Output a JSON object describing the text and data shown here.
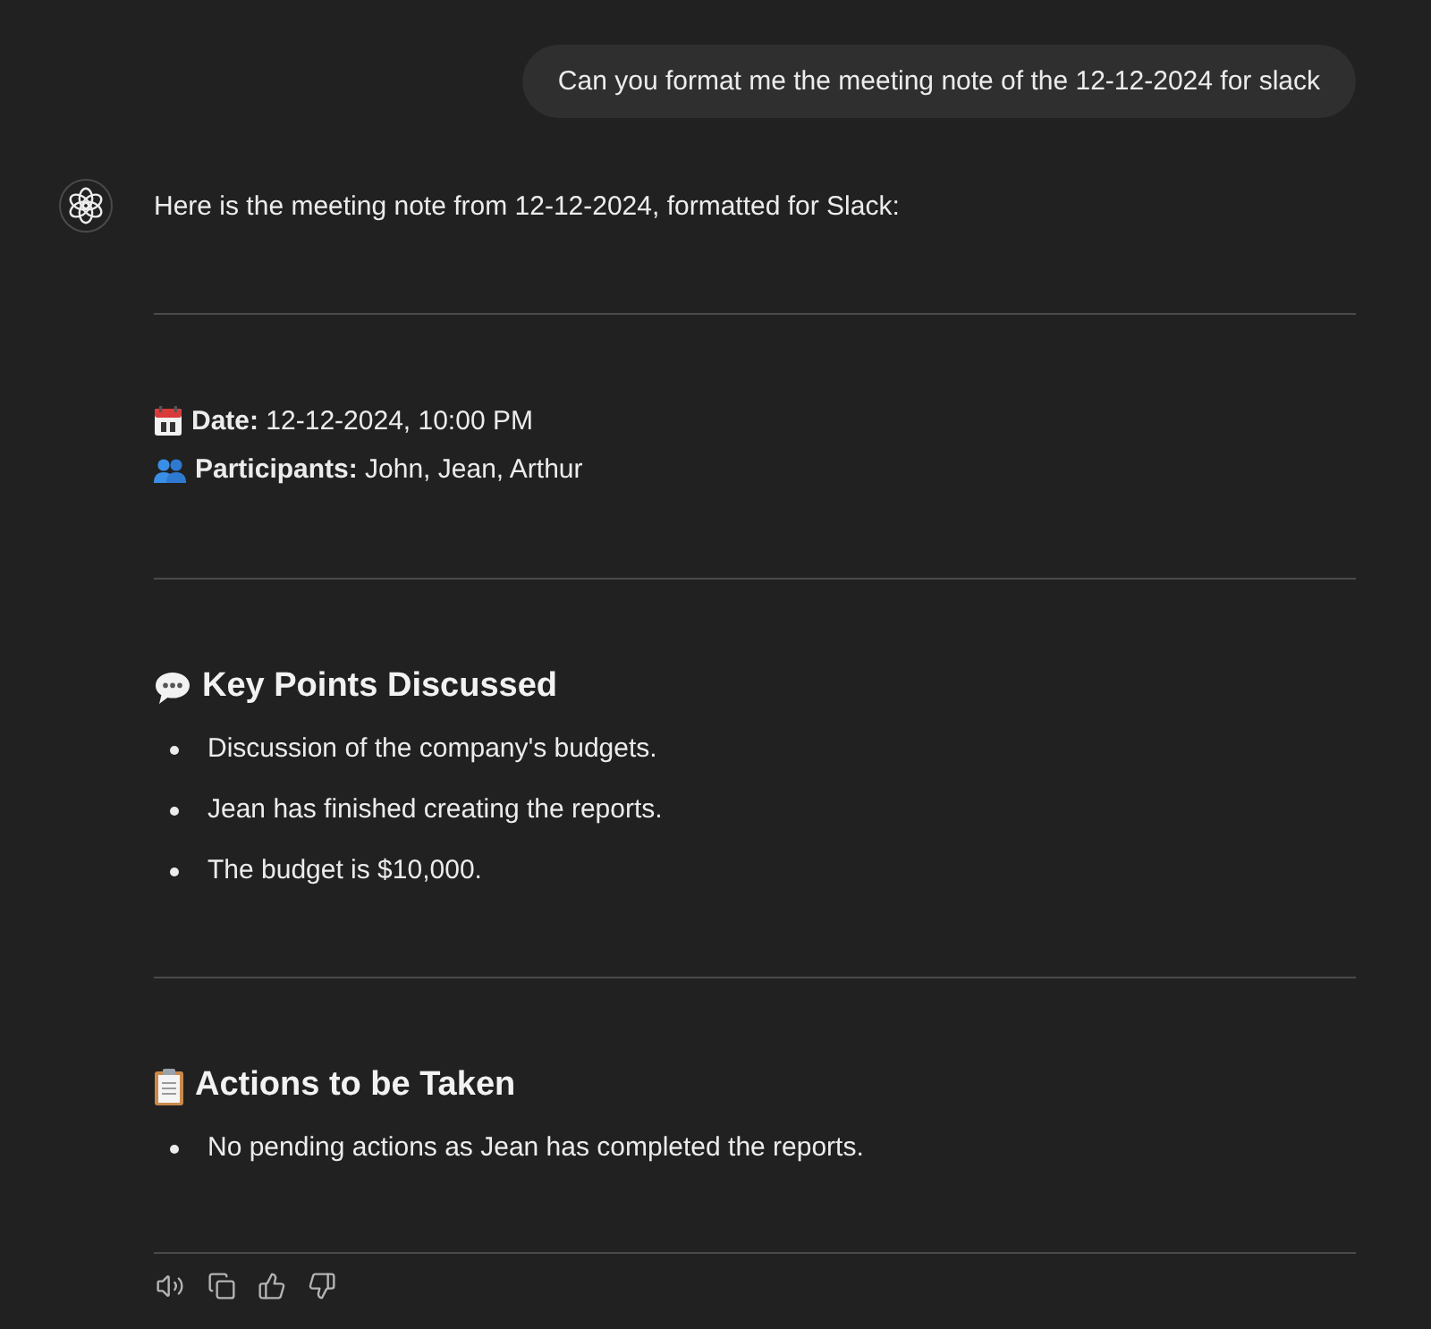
{
  "user_message": {
    "text": "Can you format me the meeting note of the 12-12-2024 for slack"
  },
  "assistant_message": {
    "intro": "Here is the meeting note from 12-12-2024, formatted for Slack:",
    "sections": [
      {
        "kind": "details",
        "lines": [
          "**Date:** 12-12-2024, 10:00 PM",
          "**Participants:** John, Jean, Arthur"
        ]
      },
      {
        "kind": "list",
        "heading": "Key Points Discussed",
        "items": [
          "Discussion of the company's budgets.",
          "Jean has finished creating the reports.",
          "The budget is $10,000."
        ]
      },
      {
        "kind": "list",
        "heading": "Actions to be Taken",
        "items": [
          "No pending actions as Jean has completed the reports."
        ]
      }
    ]
  }
}
